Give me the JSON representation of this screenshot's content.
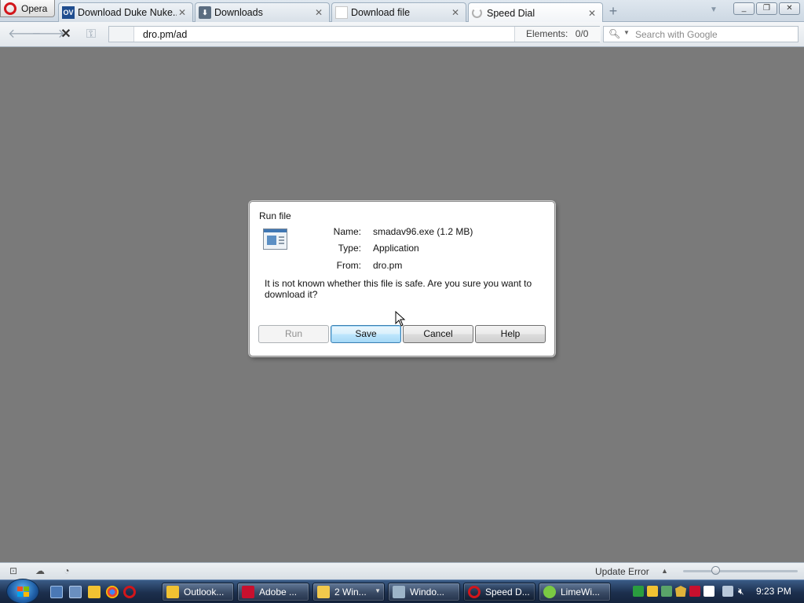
{
  "browser": {
    "menu_label": "Opera",
    "tabs": [
      {
        "label": "Download Duke Nuke...",
        "favicon": "ov-icon"
      },
      {
        "label": "Downloads",
        "favicon": "downloads-icon"
      },
      {
        "label": "Download file",
        "favicon": "page-icon"
      },
      {
        "label": "Speed Dial",
        "favicon": "loading-spinner-icon"
      }
    ],
    "active_tab_index": 3,
    "new_tab_symbol": "+",
    "window_controls": {
      "minimize": "_",
      "restore": "❐",
      "close": "✕"
    }
  },
  "toolbar": {
    "url": "dro.pm/ad",
    "elements_label": "Elements:",
    "elements_value": "0/0",
    "search_placeholder": "Search with Google"
  },
  "dialog": {
    "title": "Run file",
    "fields": [
      {
        "label": "Name:",
        "value": "smadav96.exe (1.2 MB)"
      },
      {
        "label": "Type:",
        "value": "Application"
      },
      {
        "label": "From:",
        "value": "dro.pm"
      }
    ],
    "message": "It is not known whether this file is safe. Are you sure you want to download it?",
    "buttons": {
      "run": "Run",
      "save": "Save",
      "cancel": "Cancel",
      "help": "Help"
    },
    "default_button": "save",
    "disabled_button": "run"
  },
  "status_bar": {
    "update_text": "Update Error",
    "zoom_level_fraction": 0.28
  },
  "taskbar": {
    "tasks": [
      {
        "label": "Outlook...",
        "icon": "outlook-icon",
        "color": "#f1c232"
      },
      {
        "label": "Adobe ...",
        "icon": "adobe-flash-icon",
        "color": "#c8102e"
      },
      {
        "label": "2 Win...",
        "icon": "folder-icon",
        "color": "#f2c94c"
      },
      {
        "label": "Windo...",
        "icon": "computer-icon",
        "color": "#9db4c8"
      },
      {
        "label": "Speed D...",
        "icon": "opera-icon",
        "color": "#d2161b"
      },
      {
        "label": "LimeWi...",
        "icon": "limewire-icon",
        "color": "#7ac943"
      }
    ],
    "clock": "9:23 PM"
  },
  "colors": {
    "page_background": "#7a7a7a",
    "opera_red": "#d2161b",
    "taskbar": "#1c2f4d"
  }
}
